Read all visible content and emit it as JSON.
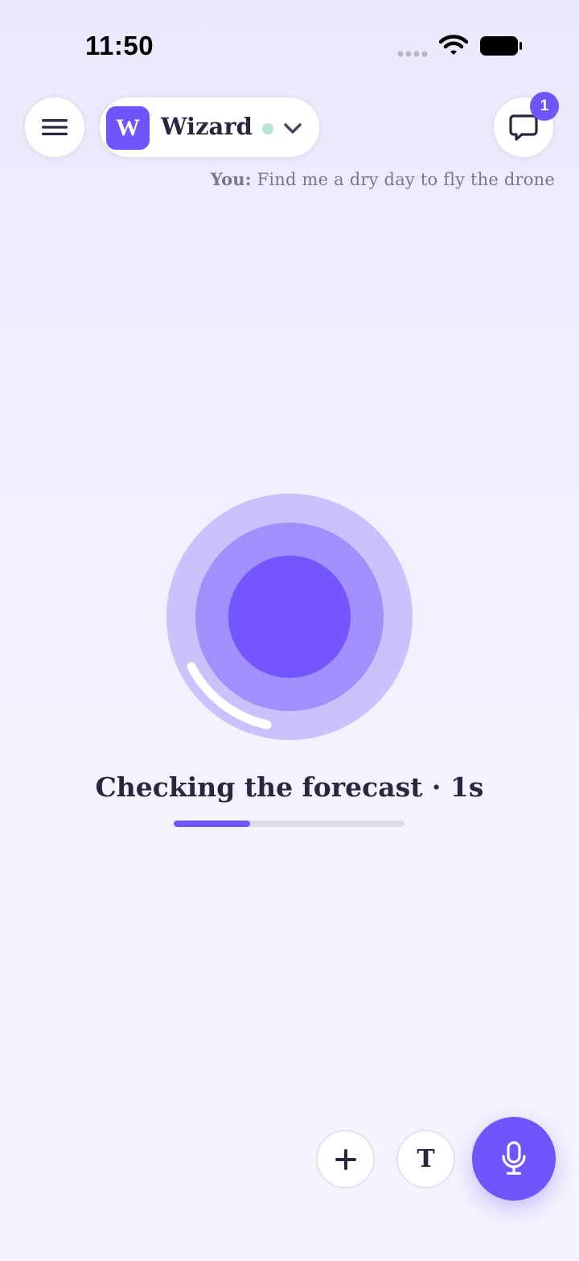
{
  "status_bar": {
    "time": "11:50"
  },
  "header": {
    "assistant": {
      "avatar_letter": "W",
      "name": "Wizard",
      "online": true
    },
    "chat_badge_count": "1"
  },
  "last_message": {
    "speaker": "You:",
    "text": "Find me a dry day to fly the drone"
  },
  "status": {
    "text": "Checking the forecast · 1s",
    "progress": 0.33
  },
  "controls": {
    "text_mode_label": "T"
  },
  "colors": {
    "accent": "#6f55fb",
    "online_dot": "#b6e6d3",
    "orb_outer": "#cbc2fd",
    "orb_middle": "#a18ffc",
    "orb_core": "#7456fc"
  },
  "icons": {
    "menu": "menu-icon",
    "chat": "chat-bubble-icon",
    "chevron": "chevron-down-icon",
    "add": "plus-icon",
    "mic": "microphone-icon"
  }
}
